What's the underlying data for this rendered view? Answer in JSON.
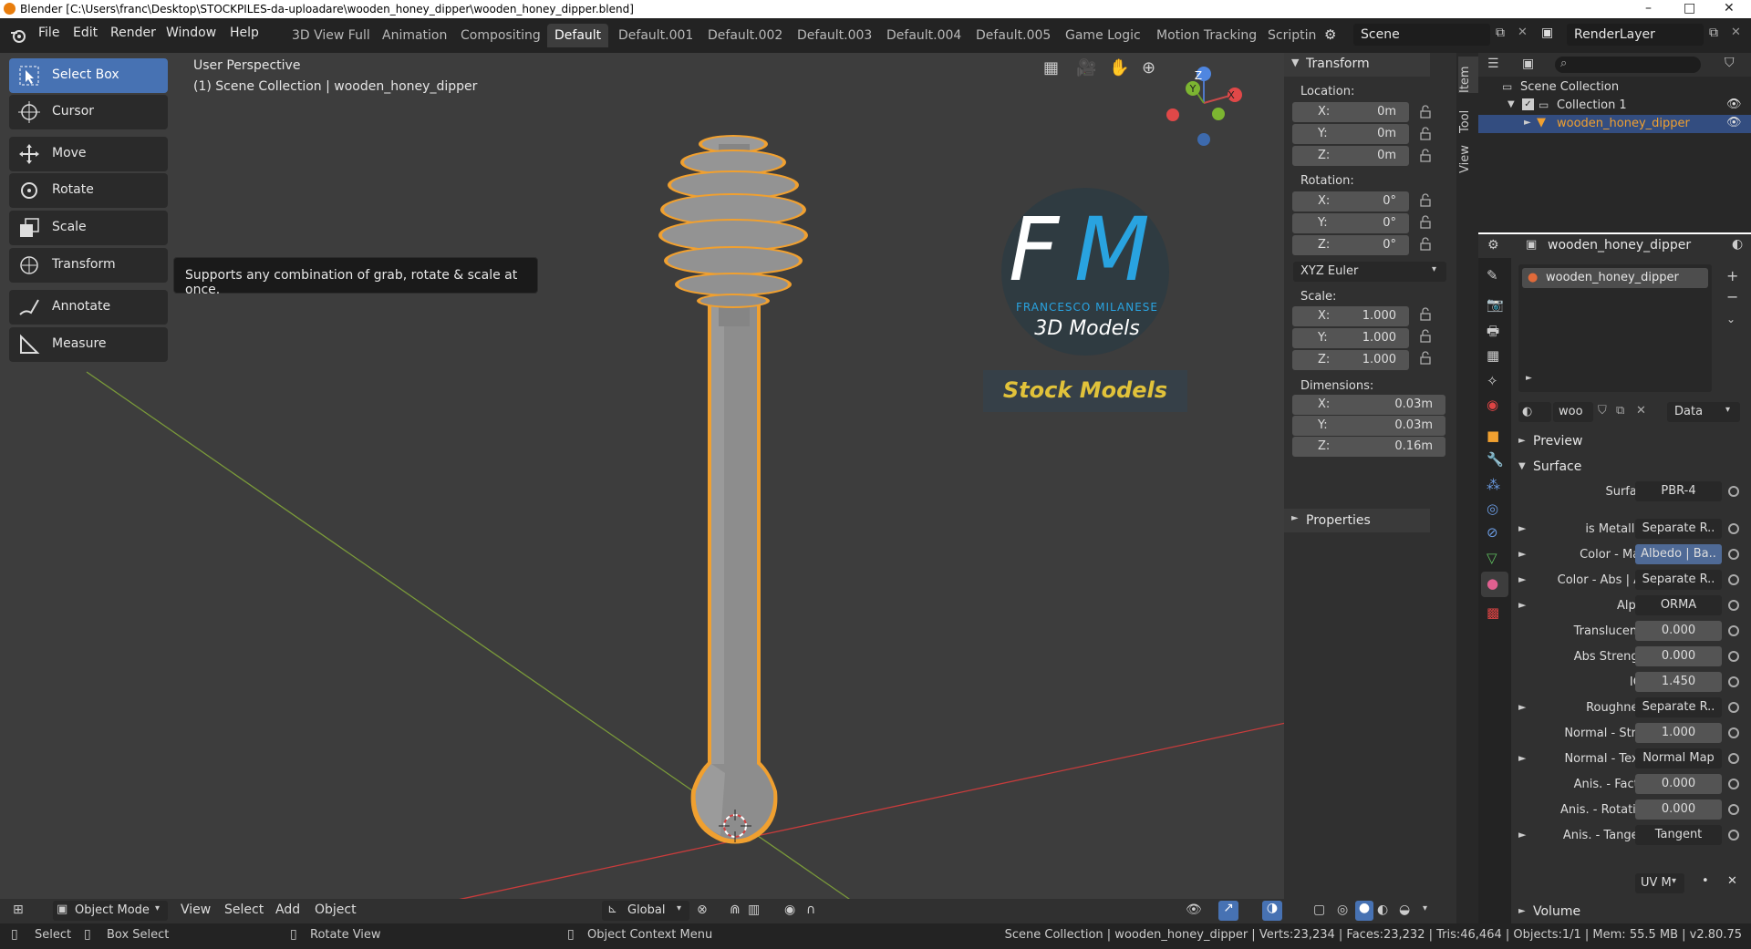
{
  "window": {
    "title": "Blender [C:\\Users\\franc\\Desktop\\STOCKPILES-da-uploadare\\wooden_honey_dipper\\wooden_honey_dipper.blend]",
    "min": "–",
    "max": "□",
    "close": "✕"
  },
  "menu": [
    "File",
    "Edit",
    "Render",
    "Window",
    "Help"
  ],
  "workspaces": [
    "3D View Full",
    "Animation",
    "Compositing",
    "Default",
    "Default.001",
    "Default.002",
    "Default.003",
    "Default.004",
    "Default.005",
    "Game Logic",
    "Motion Tracking",
    "Scriptin"
  ],
  "active_workspace": "Default",
  "scene": {
    "label": "Scene",
    "renderlayer": "RenderLayer"
  },
  "viewport": {
    "perspective": "User Perspective",
    "collection_info": "(1) Scene Collection | wooden_honey_dipper"
  },
  "tools": [
    {
      "label": "Select Box",
      "active": true
    },
    {
      "label": "Cursor"
    },
    {
      "label": "Move"
    },
    {
      "label": "Rotate"
    },
    {
      "label": "Scale"
    },
    {
      "label": "Transform"
    },
    {
      "label": "Annotate"
    },
    {
      "label": "Measure"
    }
  ],
  "tooltip": "Supports any combination of grab, rotate & scale at once.",
  "logo": {
    "letters_f": "F",
    "letters_m": "M",
    "name": "FRANCESCO MILANESE",
    "sub": "3D Models",
    "banner": "Stock Models"
  },
  "sidebar_tabs": [
    "Item",
    "Tool",
    "View"
  ],
  "transform": {
    "header": "Transform",
    "location_label": "Location:",
    "location": [
      {
        "k": "X:",
        "v": "0m"
      },
      {
        "k": "Y:",
        "v": "0m"
      },
      {
        "k": "Z:",
        "v": "0m"
      }
    ],
    "rotation_label": "Rotation:",
    "rotation": [
      {
        "k": "X:",
        "v": "0°"
      },
      {
        "k": "Y:",
        "v": "0°"
      },
      {
        "k": "Z:",
        "v": "0°"
      }
    ],
    "rotation_mode": "XYZ Euler",
    "scale_label": "Scale:",
    "scale": [
      {
        "k": "X:",
        "v": "1.000"
      },
      {
        "k": "Y:",
        "v": "1.000"
      },
      {
        "k": "Z:",
        "v": "1.000"
      }
    ],
    "dimensions_label": "Dimensions:",
    "dimensions": [
      {
        "k": "X:",
        "v": "0.03m"
      },
      {
        "k": "Y:",
        "v": "0.03m"
      },
      {
        "k": "Z:",
        "v": "0.16m"
      }
    ],
    "properties_header": "Properties"
  },
  "outliner": {
    "scene_collection": "Scene Collection",
    "collection": "Collection 1",
    "object": "wooden_honey_dipper"
  },
  "properties": {
    "object_name": "wooden_honey_dipper",
    "material_slot": "wooden_honey_dipper",
    "material_short": "woo",
    "data_dropdown": "Data",
    "preview": "Preview",
    "surface_section": "Surface",
    "rows": [
      {
        "label": "Surface",
        "value": "PBR-4",
        "tri": false,
        "num": false
      },
      {
        "label": "is Metallic?",
        "value": "Separate R..",
        "tri": true,
        "num": false
      },
      {
        "label": "Color - Main",
        "value": "Albedo | Ba..",
        "tri": true,
        "num": false,
        "hl": true
      },
      {
        "label": "Color - Abs | AO",
        "value": "Separate R..",
        "tri": true,
        "num": false
      },
      {
        "label": "Alpha",
        "value": "ORMA",
        "tri": true,
        "num": false
      },
      {
        "label": "Translucency",
        "value": "0.000",
        "tri": false,
        "num": true
      },
      {
        "label": "Abs Strength",
        "value": "0.000",
        "tri": false,
        "num": true
      },
      {
        "label": "IOR",
        "value": "1.450",
        "tri": false,
        "num": true
      },
      {
        "label": "Roughness",
        "value": "Separate R..",
        "tri": true,
        "num": false
      },
      {
        "label": "Normal - Stre..",
        "value": "1.000",
        "tri": false,
        "num": true
      },
      {
        "label": "Normal - Text..",
        "value": "Normal Map",
        "tri": true,
        "num": false
      },
      {
        "label": "Anis. - Factor",
        "value": "0.000",
        "tri": false,
        "num": true
      },
      {
        "label": "Anis. - Rotation",
        "value": "0.000",
        "tri": false,
        "num": true
      },
      {
        "label": "Anis. - Tangent",
        "value": "Tangent",
        "tri": true,
        "num": false
      }
    ],
    "uv_map": "UV M",
    "volume": "Volume"
  },
  "viewport_header": {
    "mode": "Object Mode",
    "menus": [
      "View",
      "Select",
      "Add",
      "Object"
    ],
    "orientation": "Global"
  },
  "status": {
    "select": "Select",
    "box_select": "Box Select",
    "rotate_view": "Rotate View",
    "context_menu": "Object Context Menu",
    "stats": "Scene Collection | wooden_honey_dipper | Verts:23,234 | Faces:23,232 | Tris:46,464 | Objects:1/1 | Mem: 55.5 MB | v2.80.75"
  },
  "colors": {
    "accent": "#4772b3",
    "selection": "#f0a030",
    "viewport_bg": "#3d3d3d",
    "x_axis": "#c83c3c",
    "y_axis": "#7a9a3a",
    "logo_m": "#29a3e0",
    "banner": "#e1c23a"
  }
}
